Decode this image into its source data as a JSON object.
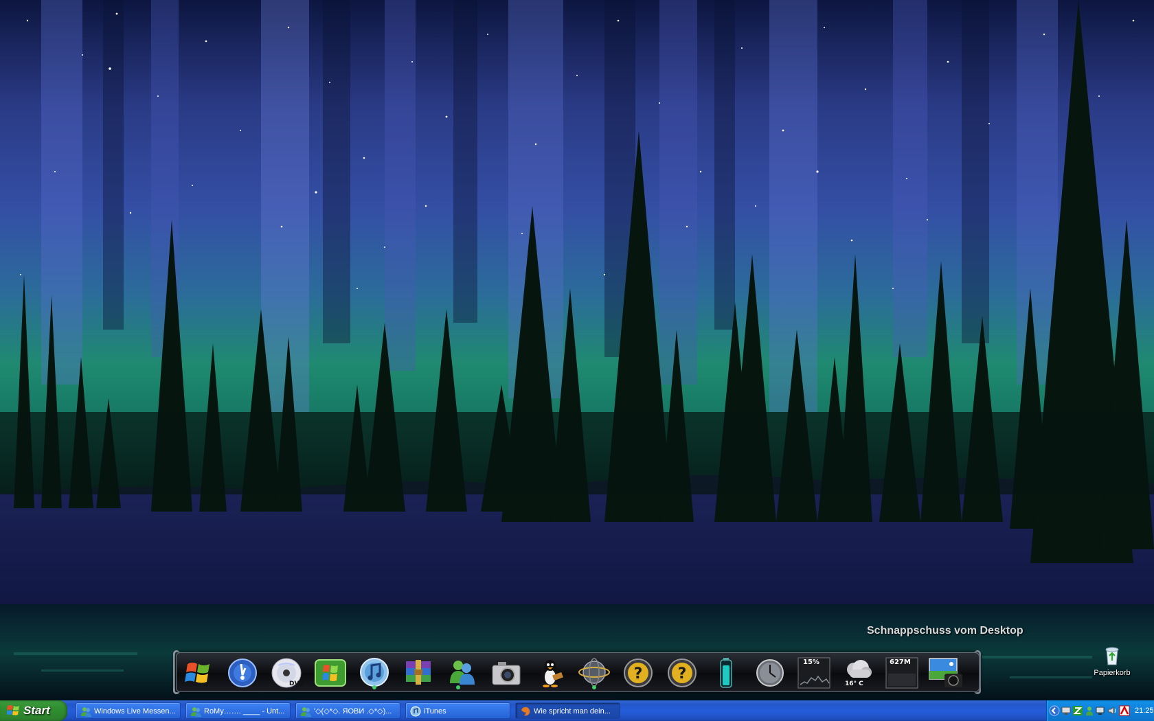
{
  "desktop": {
    "snapshot_label": "Schnappschuss vom Desktop",
    "icons": [
      {
        "label": "Papierkorb",
        "icon": "recycle-bin-icon"
      }
    ]
  },
  "dock": {
    "items": [
      {
        "name": "windows-logo",
        "icon": "windows-flag-icon"
      },
      {
        "name": "media-player",
        "icon": "media-player-icon"
      },
      {
        "name": "dvd",
        "icon": "dvd-icon",
        "text": "DVD"
      },
      {
        "name": "windows-xp",
        "icon": "windows-xp-icon"
      },
      {
        "name": "itunes",
        "icon": "itunes-icon"
      },
      {
        "name": "winrar",
        "icon": "winrar-icon"
      },
      {
        "name": "messenger",
        "icon": "messenger-icon"
      },
      {
        "name": "camera",
        "icon": "camera-icon"
      },
      {
        "name": "penguin",
        "icon": "penguin-icon"
      },
      {
        "name": "globe",
        "icon": "globe-icon"
      },
      {
        "name": "help-1",
        "icon": "question-icon"
      },
      {
        "name": "help-2",
        "icon": "question-icon"
      },
      {
        "name": "battery",
        "icon": "battery-icon"
      },
      {
        "name": "clock",
        "icon": "clock-icon"
      },
      {
        "name": "cpu-meter",
        "icon": "cpu-graph-icon",
        "text": "15%"
      },
      {
        "name": "weather",
        "icon": "weather-icon",
        "text": "16° C"
      },
      {
        "name": "memory-meter",
        "icon": "memory-graph-icon",
        "text": "627M"
      },
      {
        "name": "photo",
        "icon": "photo-camera-icon"
      }
    ]
  },
  "taskbar": {
    "start_label": "Start",
    "tasks": [
      {
        "label": "Windows Live Messen...",
        "icon": "messenger-icon",
        "active": false
      },
      {
        "label": "RoMy……. ____ - Unt...",
        "icon": "messenger-icon",
        "active": false
      },
      {
        "label": "'◇(◇*◇. ЯOBИ .◇*◇)...",
        "icon": "messenger-icon",
        "active": false
      },
      {
        "label": "iTunes",
        "icon": "itunes-icon",
        "active": false
      },
      {
        "label": "Wie spricht man dein...",
        "icon": "firefox-icon",
        "active": true
      }
    ],
    "tray_icons": [
      "arrow-icon",
      "network-icon",
      "zone-alarm-icon",
      "messenger-icon",
      "monitor-icon",
      "volume-icon",
      "antivirus-icon"
    ],
    "clock": "21:25"
  },
  "colors": {
    "taskbar_blue": "#245edb",
    "start_green": "#2f8f2f",
    "tray_blue": "#0f83de",
    "aurora_green": "#1f8a6a",
    "sky_blue": "#3a4fa0"
  }
}
